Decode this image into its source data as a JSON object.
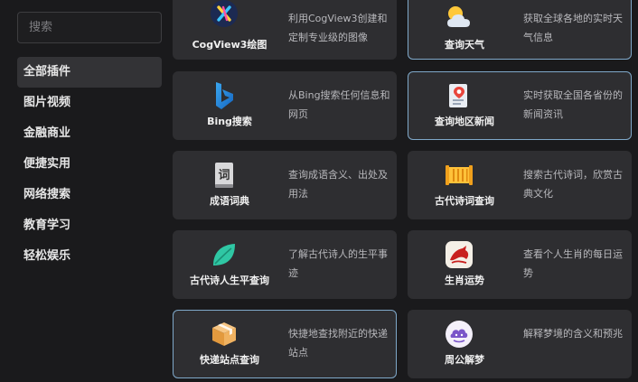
{
  "search": {
    "placeholder": "搜索"
  },
  "nav": [
    {
      "label": "全部插件",
      "active": true
    },
    {
      "label": "图片视频"
    },
    {
      "label": "金融商业"
    },
    {
      "label": "便捷实用"
    },
    {
      "label": "网络搜索"
    },
    {
      "label": "教育学习"
    },
    {
      "label": "轻松娱乐"
    }
  ],
  "plugins": [
    {
      "name": "CogView3绘图",
      "desc": "利用CogView3创建和定制专业级的图像",
      "icon": "cogview-icon"
    },
    {
      "name": "查询天气",
      "desc": "获取全球各地的实时天气信息",
      "icon": "weather-icon"
    },
    {
      "name": "Bing搜索",
      "desc": "从Bing搜索任何信息和网页",
      "icon": "bing-icon"
    },
    {
      "name": "查询地区新闻",
      "desc": "实时获取全国各省份的新闻资讯",
      "icon": "news-icon"
    },
    {
      "name": "成语词典",
      "desc": "查询成语含义、出处及用法",
      "icon": "dictionary-icon",
      "glyph": "词"
    },
    {
      "name": "古代诗词查询",
      "desc": "搜索古代诗词，欣赏古典文化",
      "icon": "poetry-icon"
    },
    {
      "name": "古代诗人生平查询",
      "desc": "了解古代诗人的生平事迹",
      "icon": "leaf-icon"
    },
    {
      "name": "生肖运势",
      "desc": "查看个人生肖的每日运势",
      "icon": "zodiac-icon"
    },
    {
      "name": "快递站点查询",
      "desc": "快捷地查找附近的快递站点",
      "icon": "package-icon"
    },
    {
      "name": "周公解梦",
      "desc": "解释梦境的含义和预兆",
      "icon": "dream-icon"
    }
  ],
  "colors": {
    "highlight_border": "#7fa8c9",
    "card_bg": "#2e2e31",
    "sidebar_active": "#333336"
  }
}
